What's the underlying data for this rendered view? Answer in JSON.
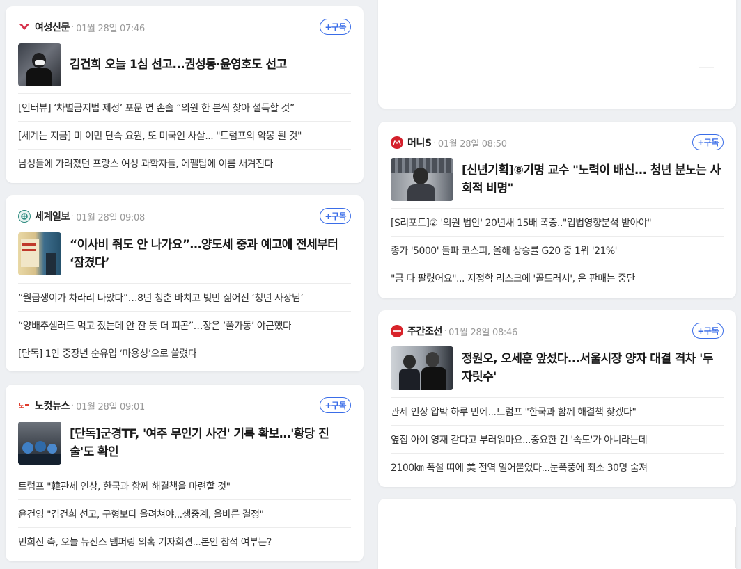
{
  "cards": [
    {
      "press": "여성신문",
      "logo_color": "#d6324b",
      "logo_icon": "yeoseong-logo",
      "date": "01월 28일 07:46",
      "subscribe": "+구독",
      "headline": "김건희 오늘 1심 선고...권성동·윤영호도 선고",
      "related": [
        "[인터뷰] ‘차별금지법 제정’ 포문 연 손솔 “의원 한 분씩 찾아 설득할 것”",
        "[세계는 지금] 미 이민 단속 요원, 또 미국인 사살... \"트럼프의 악몽 될 것\"",
        "남성들에 가려졌던 프랑스 여성 과학자들, 에펠탑에 이름 새겨진다"
      ]
    },
    {
      "press": "세계일보",
      "logo_color": "#2b8a7e",
      "logo_icon": "segye-logo",
      "date": "01월 28일 09:08",
      "subscribe": "+구독",
      "headline": "“이사비 줘도 안 나가요”…양도세 중과 예고에 전세부터 ‘잠겼다’",
      "related": [
        "“월급쟁이가 차라리 나았다”…8년 청춘 바치고 빚만 짊어진 ‘청년 사장님’",
        "“양배추샐러드 먹고 잤는데 안 잔 듯 더 피곤”…장은 ‘풀가동’ 야근했다",
        "[단독] 1인 중장년 순유입 ‘마용성’으로 쏠렸다"
      ]
    },
    {
      "press": "노컷뉴스",
      "logo_color": "#e03b2b",
      "logo_icon": "nocut-logo",
      "date": "01월 28일 09:01",
      "subscribe": "+구독",
      "headline": "[단독]군경TF, '여주 무인기 사건' 기록 확보…'황당 진술'도 확인",
      "related": [
        "트럼프 \"韓관세 인상, 한국과 함께 해결책을 마련할 것\"",
        "윤건영 \"김건희 선고, 구형보다 올려쳐야...생중계, 올바른 결정\"",
        "민희진 측, 오늘 뉴진스 탬퍼링 의혹 기자회견...본인 참석 여부는?"
      ]
    },
    {
      "press": "머니S",
      "logo_color": "#d4202c",
      "logo_icon": "moneys-logo",
      "date": "01월 28일 08:50",
      "subscribe": "+구독",
      "headline": "[신년기획]⑧기명 교수 \"노력이 배신... 청년 분노는 사회적 비명\"",
      "related": [
        "[S리포트]② '의원 법안' 20년새 15배 폭증..\"입법영향분석 받아야\"",
        "종가 '5000' 돌파 코스피, 올해 상승률 G20 중 1위 '21%'",
        "\"금 다 팔렸어요\"... 지정학 리스크에 '골드러시', 은 판매는 중단"
      ]
    },
    {
      "press": "주간조선",
      "logo_color": "#d8232a",
      "logo_icon": "weekly-chosun-logo",
      "date": "01월 28일 08:46",
      "subscribe": "+구독",
      "headline": "정원오, 오세훈 앞섰다...서울시장 양자 대결 격차 '두 자릿수'",
      "related": [
        "관세 인상 압박 하루 만에...트럼프 \"한국과 함께 해결책 찾겠다\"",
        "옆집 아이 영재 같다고 부러워마요...중요한 건 '속도'가 아니라는데",
        "2100㎞ 폭설 띠에 美 전역 얼어붙었다...눈폭풍에 최소 30명 숨져"
      ]
    }
  ],
  "dot": "·"
}
